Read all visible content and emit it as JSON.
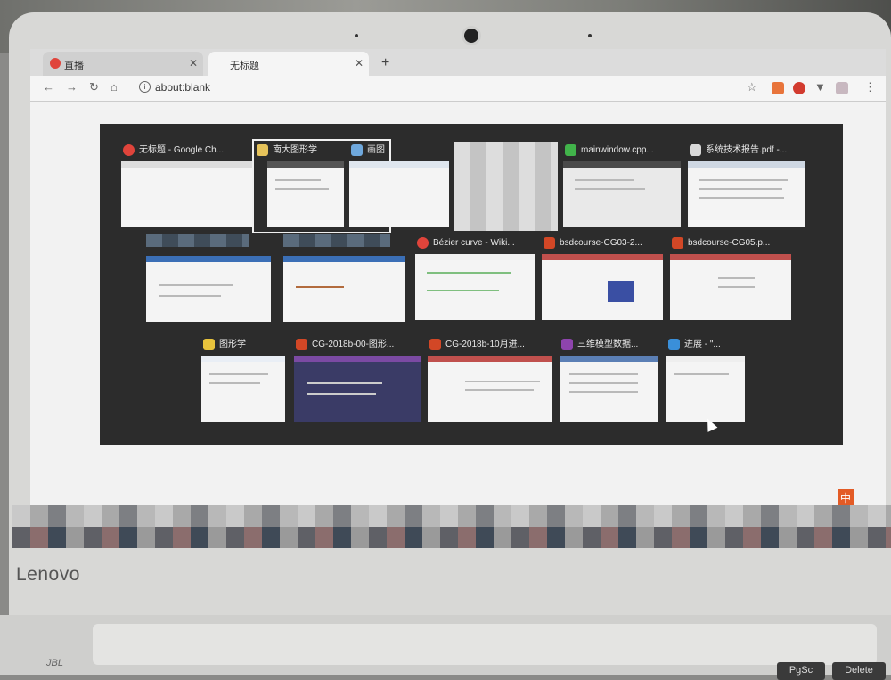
{
  "browser": {
    "tabs": [
      {
        "label": "直播"
      },
      {
        "label": "无标题"
      }
    ],
    "address": "about:blank"
  },
  "switcher": {
    "rows": [
      [
        {
          "title": "无标题 - Google Ch...",
          "icon": "chrome-icon"
        },
        {
          "title": "南大图形学",
          "icon": "folder-image-icon",
          "selected": true
        },
        {
          "title": "画图",
          "icon": "paint-icon"
        },
        {
          "title": "",
          "icon": "blurred-icon"
        },
        {
          "title": "mainwindow.cpp...",
          "icon": "qt-creator-icon"
        },
        {
          "title": "系统技术报告.pdf -...",
          "icon": "pdf-icon"
        }
      ],
      [
        {
          "title": "",
          "icon": "blurred-icon"
        },
        {
          "title": "",
          "icon": "blurred-icon"
        },
        {
          "title": "Bézier curve - Wiki...",
          "icon": "chrome-icon"
        },
        {
          "title": "bsdcourse-CG03-2...",
          "icon": "powerpoint-icon"
        },
        {
          "title": "bsdcourse-CG05.p...",
          "icon": "powerpoint-icon"
        }
      ],
      [
        {
          "title": "图形学",
          "icon": "folder-icon"
        },
        {
          "title": "CG-2018b-00-图形...",
          "icon": "powerpoint-icon"
        },
        {
          "title": "CG-2018b-10月进...",
          "icon": "powerpoint-icon"
        },
        {
          "title": "三维模型数据...",
          "icon": "winrar-icon"
        },
        {
          "title": "进展 - \"...",
          "icon": "app-icon"
        }
      ]
    ]
  },
  "laptop": {
    "brand": "Lenovo",
    "speaker_brand": "JBL"
  },
  "keys": [
    "PgSc",
    "Delete"
  ],
  "ime": "中"
}
